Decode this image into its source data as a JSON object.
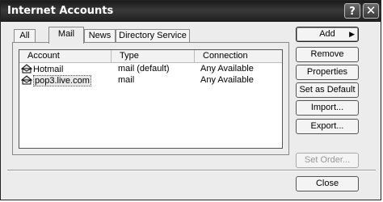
{
  "window": {
    "title": "Internet Accounts",
    "help_label": "?",
    "close_label": "✕"
  },
  "tabs": [
    {
      "label": "All"
    },
    {
      "label": "Mail"
    },
    {
      "label": "News"
    },
    {
      "label": "Directory Service"
    }
  ],
  "active_tab": "Mail",
  "list": {
    "columns": [
      "Account",
      "Type",
      "Connection"
    ],
    "rows": [
      {
        "account": "Hotmail",
        "type": "mail (default)",
        "connection": "Any Available",
        "icon": "mail-account-icon"
      },
      {
        "account": "pop3.live.com",
        "type": "mail",
        "connection": "Any Available",
        "icon": "mail-account-icon",
        "selected": true
      }
    ]
  },
  "buttons": {
    "add": "Add",
    "add_arrow": "▶",
    "remove": "Remove",
    "properties": "Properties",
    "set_default": "Set as Default",
    "import": "Import...",
    "export": "Export...",
    "set_order": "Set Order...",
    "close": "Close"
  }
}
